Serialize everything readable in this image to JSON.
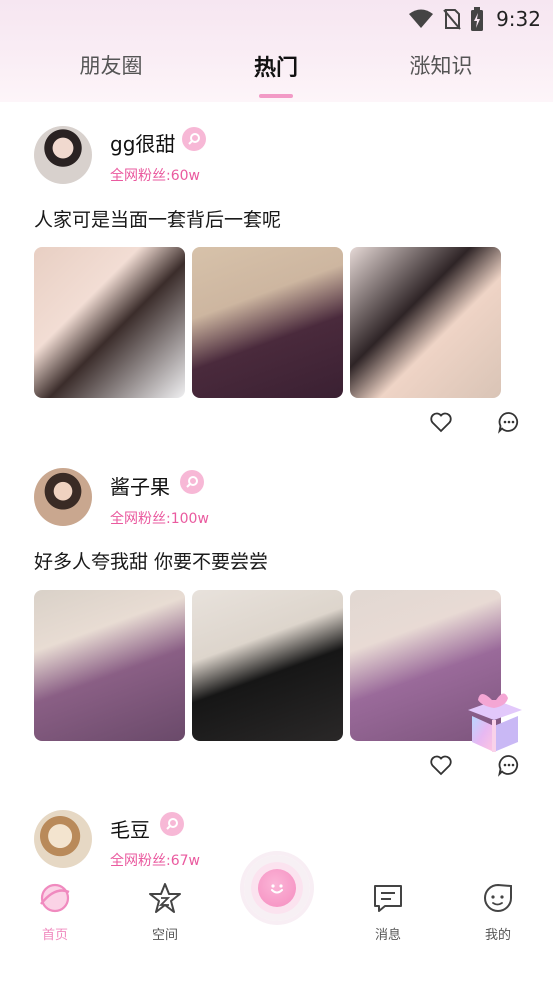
{
  "status_bar": {
    "time": "9:32",
    "icons": [
      "wifi-icon",
      "no-sim-icon",
      "battery-charging-icon"
    ]
  },
  "tabs": [
    {
      "label": "朋友圈",
      "active": false
    },
    {
      "label": "热门",
      "active": true
    },
    {
      "label": "涨知识",
      "active": false
    }
  ],
  "posts": [
    {
      "username": "gg很甜",
      "gender": "female-icon",
      "fans": "全网粉丝:60w",
      "text": "人家可是当面一套背后一套呢",
      "photo_count": 3
    },
    {
      "username": "酱子果",
      "gender": "female-icon",
      "fans": "全网粉丝:100w",
      "text": "好多人夸我甜 你要不要尝尝",
      "photo_count": 3
    },
    {
      "username": "毛豆",
      "gender": "female-icon",
      "fans": "全网粉丝:67w",
      "text": "",
      "photo_count": 0
    }
  ],
  "bottom_nav": [
    {
      "label": "首页",
      "icon": "home-icon",
      "active": true
    },
    {
      "label": "空间",
      "icon": "star-icon",
      "active": false
    },
    {
      "label": "",
      "icon": "smile-face-icon",
      "active": false
    },
    {
      "label": "消息",
      "icon": "message-icon",
      "active": false
    },
    {
      "label": "我的",
      "icon": "profile-face-icon",
      "active": false
    }
  ],
  "colors": {
    "accent": "#f08abf",
    "fans_text": "#ea5a9f",
    "badge": "#f7b8d6",
    "header_bg": "#f6e6f1"
  }
}
